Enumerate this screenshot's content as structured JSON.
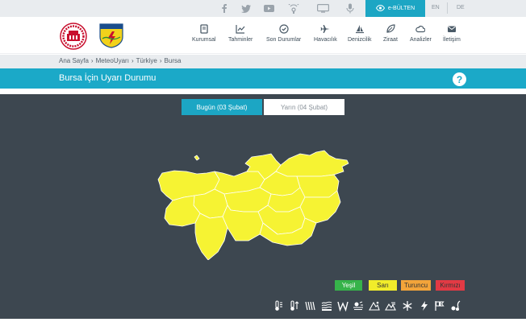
{
  "topbar": {
    "social_icons": [
      "facebook-icon",
      "twitter-icon",
      "youtube-icon",
      "satellite-icon",
      "tv-icon",
      "podcast-icon"
    ],
    "ebulten_label": "e-BÜLTEN",
    "lang_en": "EN",
    "lang_de": "DE"
  },
  "nav": {
    "items": [
      {
        "label": "Kurumsal",
        "icon": "book-icon"
      },
      {
        "label": "Tahminler",
        "icon": "chart-icon"
      },
      {
        "label": "Son Durumlar",
        "icon": "clock-icon"
      },
      {
        "label": "Havacılık",
        "icon": "plane-icon"
      },
      {
        "label": "Denizcilik",
        "icon": "sail-icon"
      },
      {
        "label": "Ziraat",
        "icon": "leaf-icon"
      },
      {
        "label": "Analizler",
        "icon": "cloud-icon"
      },
      {
        "label": "İletişim",
        "icon": "mail-icon"
      }
    ]
  },
  "breadcrumb": {
    "items": [
      "Ana Sayfa",
      "MeteoUyarı",
      "Türkiye",
      "Bursa"
    ],
    "separator": "›"
  },
  "page": {
    "title": "Bursa İçin Uyarı Durumu",
    "help": "?"
  },
  "tabs": {
    "today": "Bugün (03 Şubat)",
    "tomorrow": "Yarın (04 Şubat)"
  },
  "map": {
    "region": "Bursa",
    "fill_color": "#f6f333",
    "border_color": "#ffffff"
  },
  "legend": {
    "green": "Yeşil",
    "yellow": "Sarı",
    "orange": "Turuncu",
    "red": "Kırmızı",
    "colors": {
      "green": "#36b34a",
      "yellow": "#f1ec2a",
      "orange": "#f3a43a",
      "red": "#e23a44"
    }
  },
  "hazards": [
    "hot-temperature-icon",
    "cold-temperature-icon",
    "rain-icon",
    "snow-icon",
    "wind-icon",
    "fog-icon",
    "avalanche-icon",
    "dust-icon",
    "frost-icon",
    "lightning-icon",
    "storm-flag-icon",
    "thunderstorm-icon"
  ]
}
